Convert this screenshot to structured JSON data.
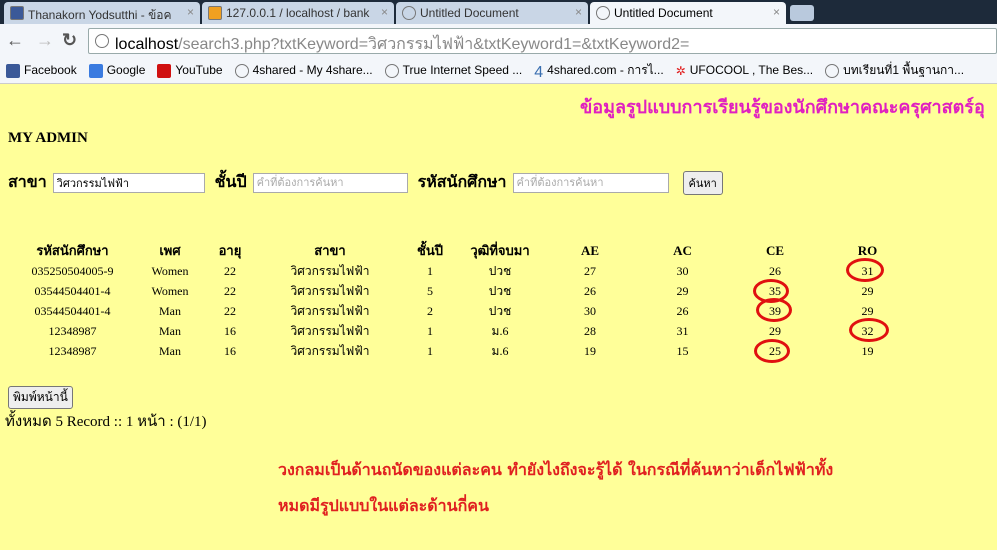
{
  "browser": {
    "tabs": [
      {
        "label": "Thanakorn Yodsutthi - ข้อค"
      },
      {
        "label": "127.0.0.1 / localhost / bank"
      },
      {
        "label": "Untitled Document"
      },
      {
        "label": "Untitled Document"
      }
    ],
    "url_host": "localhost",
    "url_path": "/search3.php?txtKeyword=วิศวกรรมไฟฟ้า&txtKeyword1=&txtKeyword2=",
    "bookmarks": [
      "Facebook",
      "Google",
      "YouTube",
      "4shared - My 4share...",
      "True Internet Speed ...",
      "4shared.com - การไ...",
      "UFOCOOL , The Bes...",
      "บทเรียนที่1 พื้นฐานกา..."
    ]
  },
  "page": {
    "title": "ข้อมูลรูปแบบการเรียนรู้ของนักศึกษาคณะครุศาสตร์อุ",
    "admin": "MY ADMIN",
    "search": {
      "branch_label": "สาขา",
      "branch_value": "วิศวกรรมไฟฟ้า",
      "year_label": "ชั้นปี",
      "year_placeholder": "คำที่ต้องการค้นหา",
      "id_label": "รหัสนักศึกษา",
      "id_placeholder": "คำที่ต้องการค้นหา",
      "button": "ค้นหา"
    },
    "table": {
      "headers": [
        "รหัสนักศึกษา",
        "เพศ",
        "อายุ",
        "สาขา",
        "ชั้นปี",
        "วุฒิที่จบมา",
        "AE",
        "AC",
        "CE",
        "RO"
      ],
      "rows": [
        [
          "035250504005-9",
          "Women",
          "22",
          "วิศวกรรมไฟฟ้า",
          "1",
          "ปวช",
          "27",
          "30",
          "26",
          "31"
        ],
        [
          "03544504401-4",
          "Women",
          "22",
          "วิศวกรรมไฟฟ้า",
          "5",
          "ปวช",
          "26",
          "29",
          "35",
          "29"
        ],
        [
          "03544504401-4",
          "Man",
          "22",
          "วิศวกรรมไฟฟ้า",
          "2",
          "ปวช",
          "30",
          "26",
          "39",
          "29"
        ],
        [
          "12348987",
          "Man",
          "16",
          "วิศวกรรมไฟฟ้า",
          "1",
          "ม.6",
          "28",
          "31",
          "29",
          "32"
        ],
        [
          "12348987",
          "Man",
          "16",
          "วิศวกรรมไฟฟ้า",
          "1",
          "ม.6",
          "19",
          "15",
          "25",
          "19"
        ]
      ]
    },
    "print_button": "พิมพ์หน้านี้",
    "total": "ทั้งหมด 5 Record :: 1 หน้า : (1/1)",
    "note_line1": "วงกลมเป็นด้านถนัดของแต่ละคน ทำยังไงถึงจะรู้ได้ ในกรณีที่ค้นหาว่าเด็กไฟฟ้าทั้ง",
    "note_line2": "หมดมีรูปแบบในแต่ละด้านกี่คน",
    "circle_color": "#e01010"
  }
}
